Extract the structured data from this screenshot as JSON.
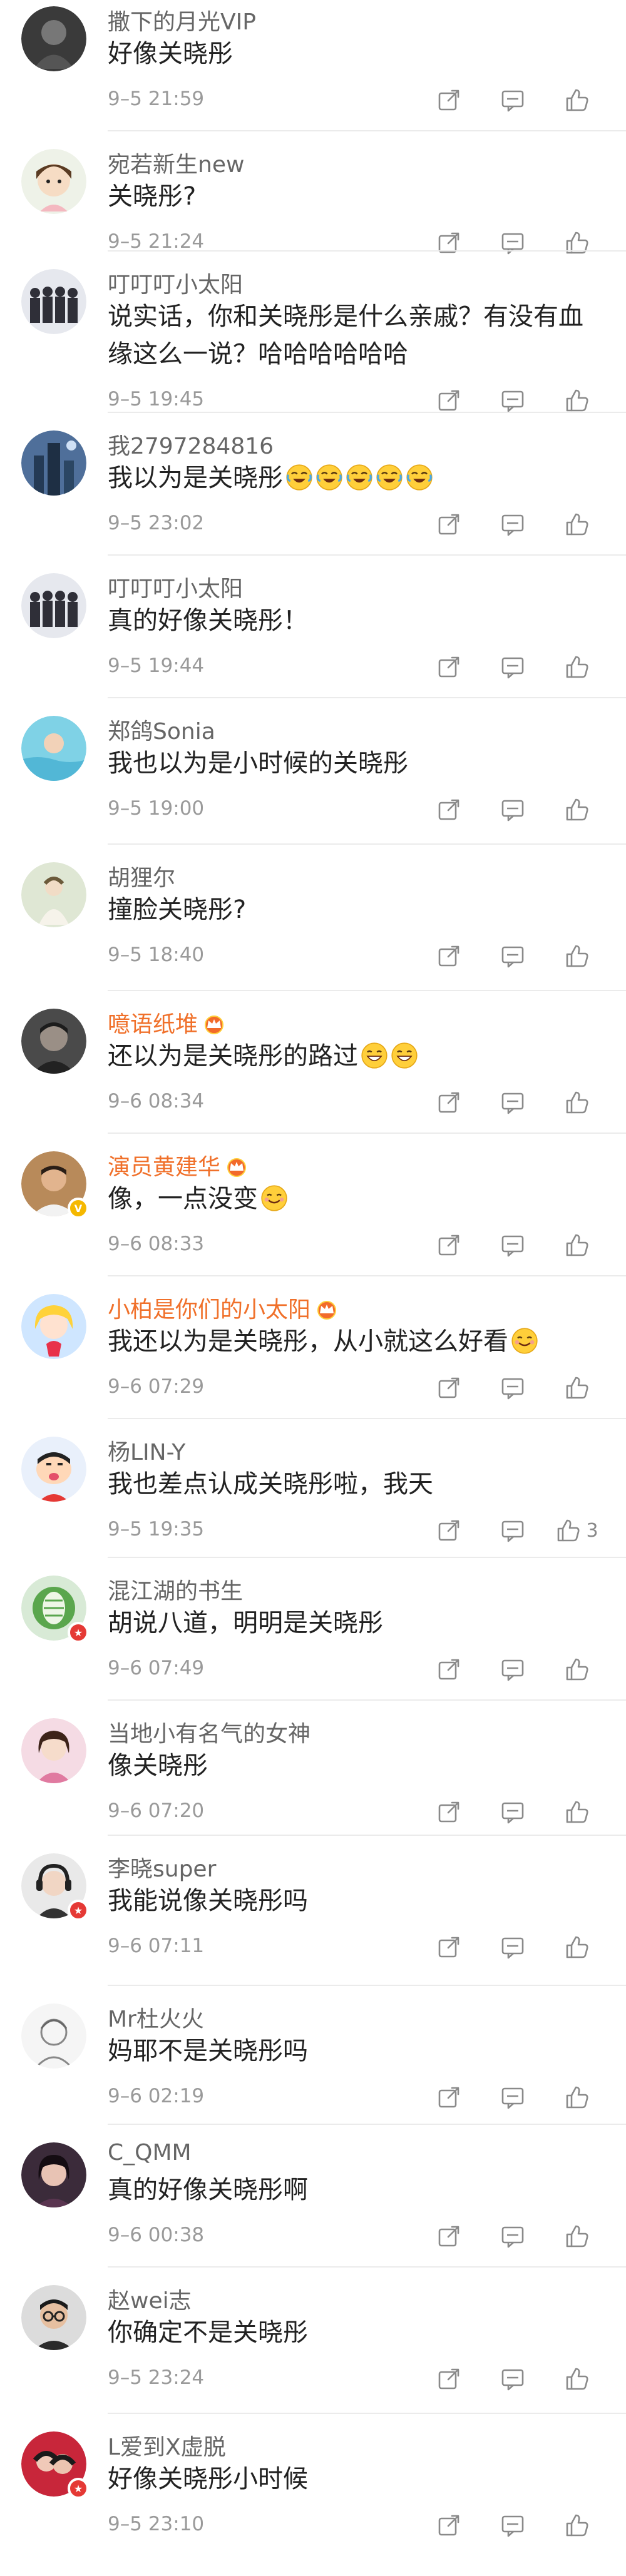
{
  "comments": [
    {
      "user": "撒下的月光VIP",
      "vip": false,
      "text": "好像关晓彤",
      "time": "9–5 21:59",
      "likes": "",
      "avatar": "dark-bw",
      "badge": "",
      "emoji": "",
      "emoji_count": 0
    },
    {
      "user": "宛若新生new",
      "vip": false,
      "text": "关晓彤?",
      "time": "9–5 21:24",
      "likes": "",
      "avatar": "cartoon-girl",
      "badge": "",
      "emoji": "",
      "emoji_count": 0
    },
    {
      "user": "叮叮叮小太阳",
      "vip": false,
      "text": "说实话，你和关晓彤是什么亲戚？有没有血缘这么一说？哈哈哈哈哈哈",
      "time": "9–5 19:45",
      "likes": "",
      "avatar": "group",
      "badge": "",
      "emoji": "",
      "emoji_count": 0
    },
    {
      "user": "我2797284816",
      "vip": false,
      "text": "我以为是关晓彤",
      "time": "9–5 23:02",
      "likes": "",
      "avatar": "city",
      "badge": "",
      "emoji": "laugh-cry",
      "emoji_count": 5
    },
    {
      "user": "叮叮叮小太阳",
      "vip": false,
      "text": "真的好像关晓彤！",
      "time": "9–5 19:44",
      "likes": "",
      "avatar": "group",
      "badge": "",
      "emoji": "",
      "emoji_count": 0
    },
    {
      "user": "郑鸽Sonia",
      "vip": false,
      "text": "我也以为是小时候的关晓彤",
      "time": "9–5 19:00",
      "likes": "",
      "avatar": "pool",
      "badge": "",
      "emoji": "",
      "emoji_count": 0
    },
    {
      "user": "胡狸尔",
      "vip": false,
      "text": "撞脸关晓彤?",
      "time": "9–5 18:40",
      "likes": "",
      "avatar": "painting",
      "badge": "",
      "emoji": "",
      "emoji_count": 0
    },
    {
      "user": "噫语纸堆",
      "vip": true,
      "text": "还以为是关晓彤的路过",
      "time": "9–6 08:34",
      "likes": "",
      "avatar": "dark-portrait",
      "badge": "",
      "emoji": "grin",
      "emoji_count": 2
    },
    {
      "user": "演员黄建华",
      "vip": true,
      "text": "像，一点没变",
      "time": "9–6 08:33",
      "likes": "",
      "avatar": "man-photo",
      "badge": "yellow",
      "emoji": "smile",
      "emoji_count": 1
    },
    {
      "user": "小柏是你们的小太阳",
      "vip": true,
      "text": "我还以为是关晓彤，从小就这么好看",
      "time": "9–6 07:29",
      "likes": "",
      "avatar": "anime",
      "badge": "",
      "emoji": "smile",
      "emoji_count": 1
    },
    {
      "user": "杨LIN-Y",
      "vip": false,
      "text": "我也差点认成关晓彤啦，我天",
      "time": "9–5 19:35",
      "likes": "3",
      "avatar": "shinchan",
      "badge": "",
      "emoji": "",
      "emoji_count": 0
    },
    {
      "user": "混江湖的书生",
      "vip": false,
      "text": "胡说八道，明明是关晓彤",
      "time": "9–6 07:49",
      "likes": "",
      "avatar": "green-icon",
      "badge": "red",
      "emoji": "",
      "emoji_count": 0
    },
    {
      "user": "当地小有名气的女神",
      "vip": false,
      "text": "像关晓彤",
      "time": "9–6 07:20",
      "likes": "",
      "avatar": "pink-girl",
      "badge": "",
      "emoji": "",
      "emoji_count": 0
    },
    {
      "user": "李晓super",
      "vip": false,
      "text": "我能说像关晓彤吗",
      "time": "9–6 07:11",
      "likes": "",
      "avatar": "girl-headphones",
      "badge": "red",
      "emoji": "",
      "emoji_count": 0
    },
    {
      "user": "Mr杜火火",
      "vip": false,
      "text": "妈耶不是关晓彤吗",
      "time": "9–6 02:19",
      "likes": "",
      "avatar": "sketch",
      "badge": "",
      "emoji": "",
      "emoji_count": 0
    },
    {
      "user": "C_QMM",
      "vip": false,
      "text": "真的好像关晓彤啊",
      "time": "9–6 00:38",
      "likes": "",
      "avatar": "dark-girl",
      "badge": "",
      "emoji": "",
      "emoji_count": 0
    },
    {
      "user": "赵wei志",
      "vip": false,
      "text": "你确定不是关晓彤",
      "time": "9–5 23:24",
      "likes": "",
      "avatar": "man-glasses",
      "badge": "",
      "emoji": "",
      "emoji_count": 0
    },
    {
      "user": "L爱到X虚脱",
      "vip": false,
      "text": "好像关晓彤小时候",
      "time": "9–5 23:10",
      "likes": "",
      "avatar": "red-photo",
      "badge": "red",
      "emoji": "",
      "emoji_count": 0
    }
  ],
  "icons": {
    "share": "share-icon",
    "comment": "comment-icon",
    "like": "thumbs-up-icon",
    "vip_crown": "crown-icon"
  },
  "colors": {
    "username": "#666666",
    "vip_username": "#f0702a",
    "text": "#222222",
    "time": "#9a9a9a",
    "icon": "#8a8a8a"
  }
}
